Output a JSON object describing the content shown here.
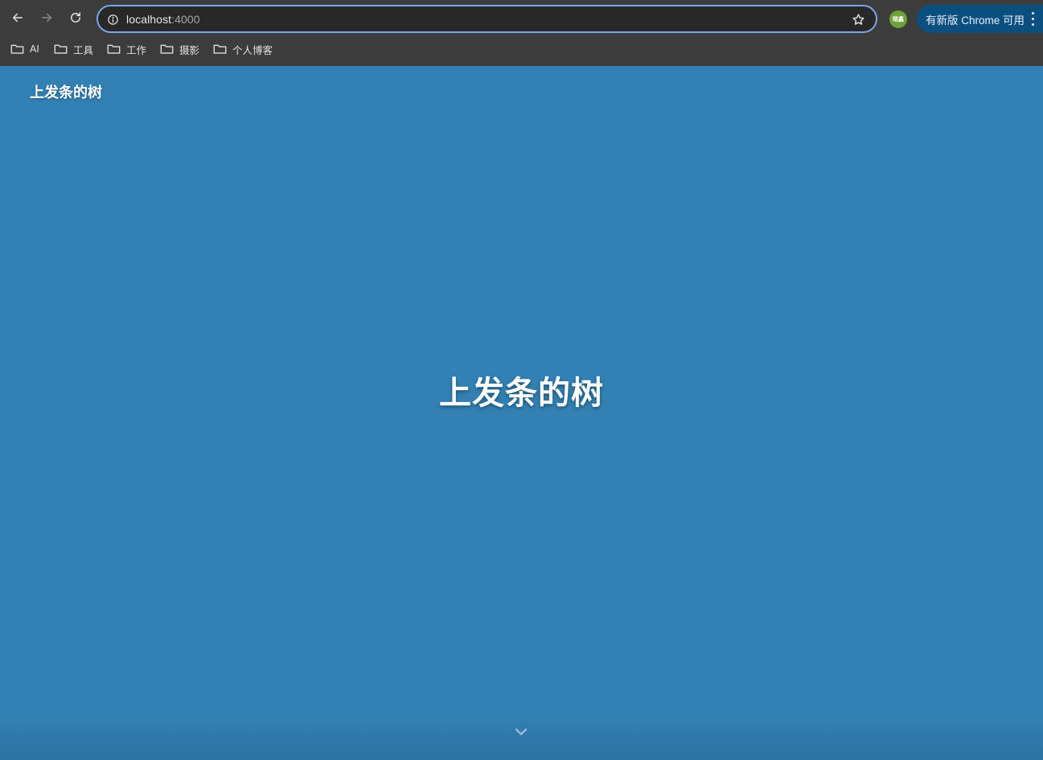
{
  "browser": {
    "url_host": "localhost",
    "url_port": ":4000",
    "profile_initials": "晓鑫",
    "update_label": "有新版 Chrome 可用",
    "bookmarks": [
      {
        "label": "AI"
      },
      {
        "label": "工具"
      },
      {
        "label": "工作"
      },
      {
        "label": "摄影"
      },
      {
        "label": "个人博客"
      }
    ]
  },
  "site": {
    "header_title": "上发条的树",
    "hero_title": "上发条的树"
  },
  "colors": {
    "page_background": "#3381b4",
    "chrome_background": "#3c3c3c",
    "omnibox_border": "#7ca7e8",
    "update_pill": "#0b4f7e"
  },
  "icons": {
    "back": "arrow-left-icon",
    "forward": "arrow-right-icon",
    "reload": "reload-icon",
    "site_info": "info-icon",
    "bookmark_star": "star-icon",
    "bookmark_folder": "folder-icon",
    "menu": "kebab-menu-icon",
    "scroll": "chevron-down-icon"
  }
}
